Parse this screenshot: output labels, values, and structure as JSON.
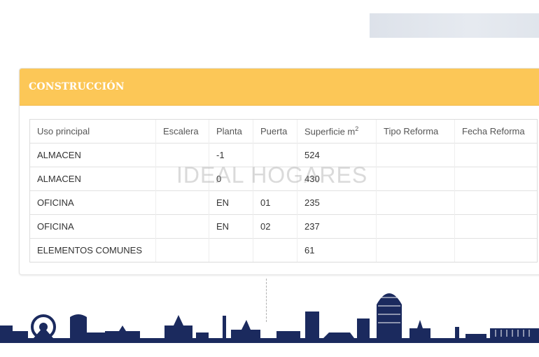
{
  "section": {
    "title": "CONSTRUCCIÓN"
  },
  "table": {
    "headers": {
      "uso": "Uso principal",
      "escalera": "Escalera",
      "planta": "Planta",
      "puerta": "Puerta",
      "superficie": "Superficie m",
      "superficie_sup": "2",
      "tipo": "Tipo Reforma",
      "fecha": "Fecha Reforma"
    },
    "rows": [
      {
        "uso": "ALMACEN",
        "escalera": "",
        "planta": "-1",
        "puerta": "",
        "superficie": "524",
        "tipo": "",
        "fecha": ""
      },
      {
        "uso": "ALMACEN",
        "escalera": "",
        "planta": "0",
        "puerta": "",
        "superficie": "430",
        "tipo": "",
        "fecha": ""
      },
      {
        "uso": "OFICINA",
        "escalera": "",
        "planta": "EN",
        "puerta": "01",
        "superficie": "235",
        "tipo": "",
        "fecha": ""
      },
      {
        "uso": "OFICINA",
        "escalera": "",
        "planta": "EN",
        "puerta": "02",
        "superficie": "237",
        "tipo": "",
        "fecha": ""
      },
      {
        "uso": "ELEMENTOS COMUNES",
        "escalera": "",
        "planta": "",
        "puerta": "",
        "superficie": "61",
        "tipo": "",
        "fecha": ""
      }
    ]
  },
  "watermark": "IDEAL HOGARES",
  "colors": {
    "header_bg": "#fcc757",
    "skyline": "#1b2a5e"
  }
}
